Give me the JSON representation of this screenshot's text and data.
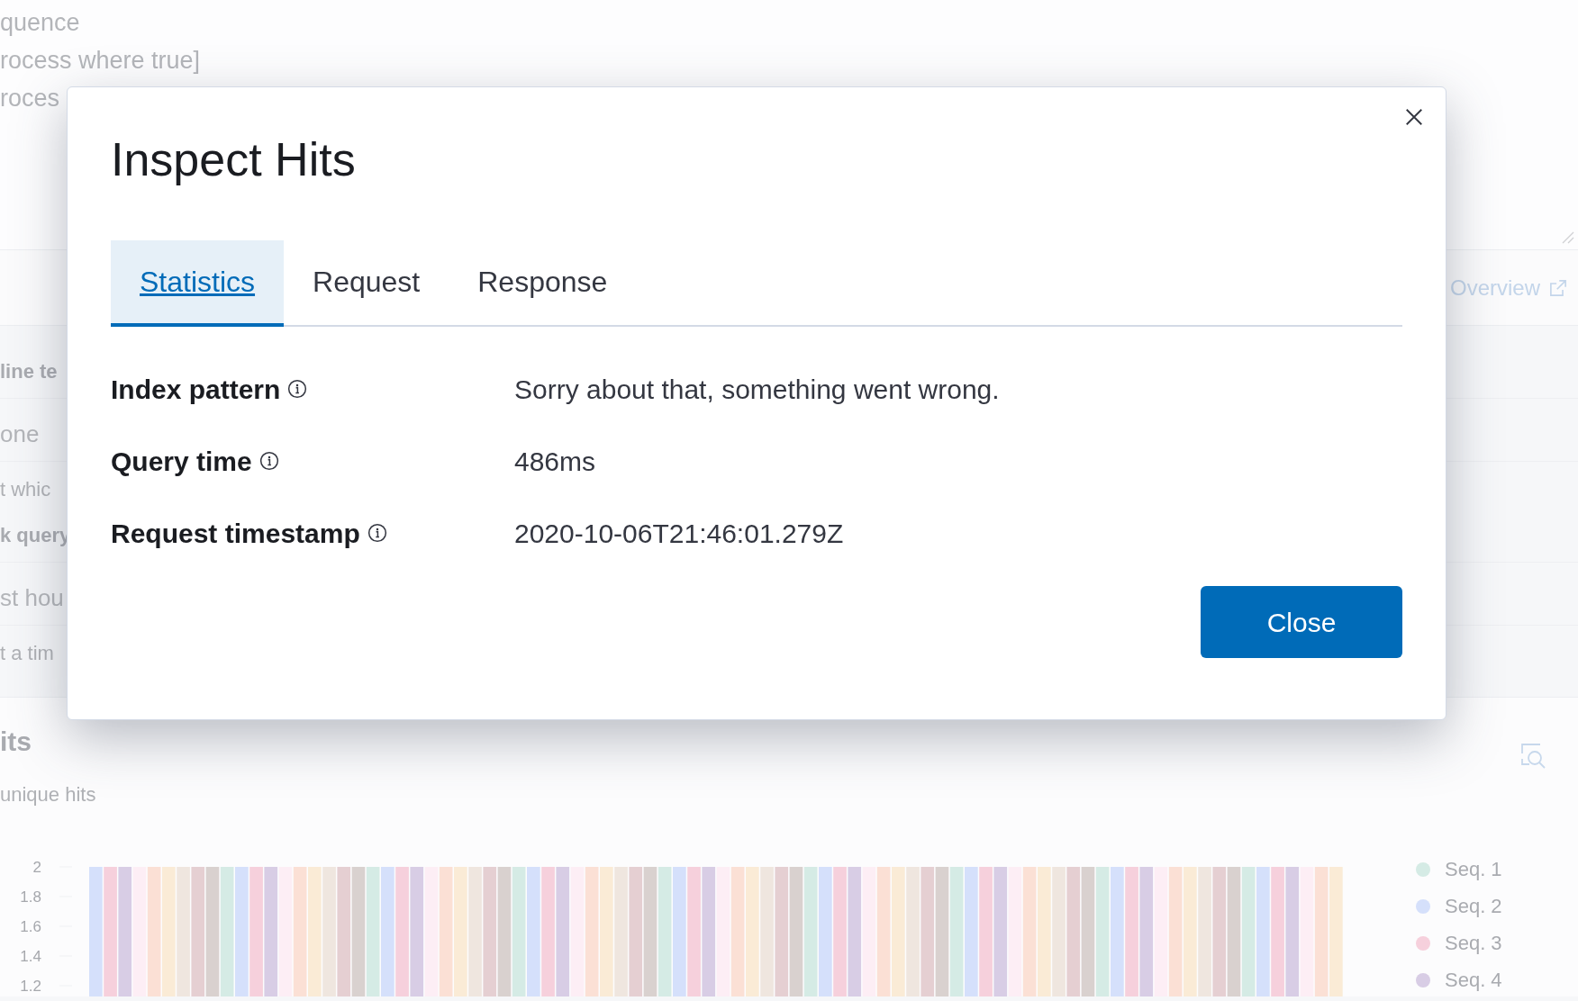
{
  "background": {
    "query_lines": [
      "quence",
      "rocess where true]",
      "roces"
    ],
    "overview_link": "Overview",
    "form_rows": [
      {
        "kind": "label",
        "text": "line te"
      },
      {
        "kind": "value",
        "text": "one"
      },
      {
        "kind": "help",
        "text": "t whic"
      },
      {
        "kind": "label",
        "text": "k query"
      },
      {
        "kind": "value",
        "text": "st hou"
      },
      {
        "kind": "help",
        "text": "t a tim"
      }
    ],
    "hits_panel": {
      "title": "its",
      "subtitle": "unique hits",
      "y_axis_labels": [
        "2",
        "1.8",
        "1.6",
        "1.4",
        "1.2"
      ],
      "legend": [
        {
          "label": "Seq. 1",
          "color": "#d5ebe5"
        },
        {
          "label": "Seq. 2",
          "color": "#d5e0fb"
        },
        {
          "label": "Seq. 3",
          "color": "#f6d0dc"
        },
        {
          "label": "Seq. 4",
          "color": "#d8cde5"
        }
      ]
    }
  },
  "modal": {
    "title": "Inspect Hits",
    "tabs": [
      {
        "label": "Statistics",
        "selected": true
      },
      {
        "label": "Request",
        "selected": false
      },
      {
        "label": "Response",
        "selected": false
      }
    ],
    "stats": [
      {
        "label": "Index pattern",
        "value": "Sorry about that, something went wrong."
      },
      {
        "label": "Query time",
        "value": "486ms"
      },
      {
        "label": "Request timestamp",
        "value": "2020-10-06T21:46:01.279Z"
      }
    ],
    "close_button": "Close"
  }
}
